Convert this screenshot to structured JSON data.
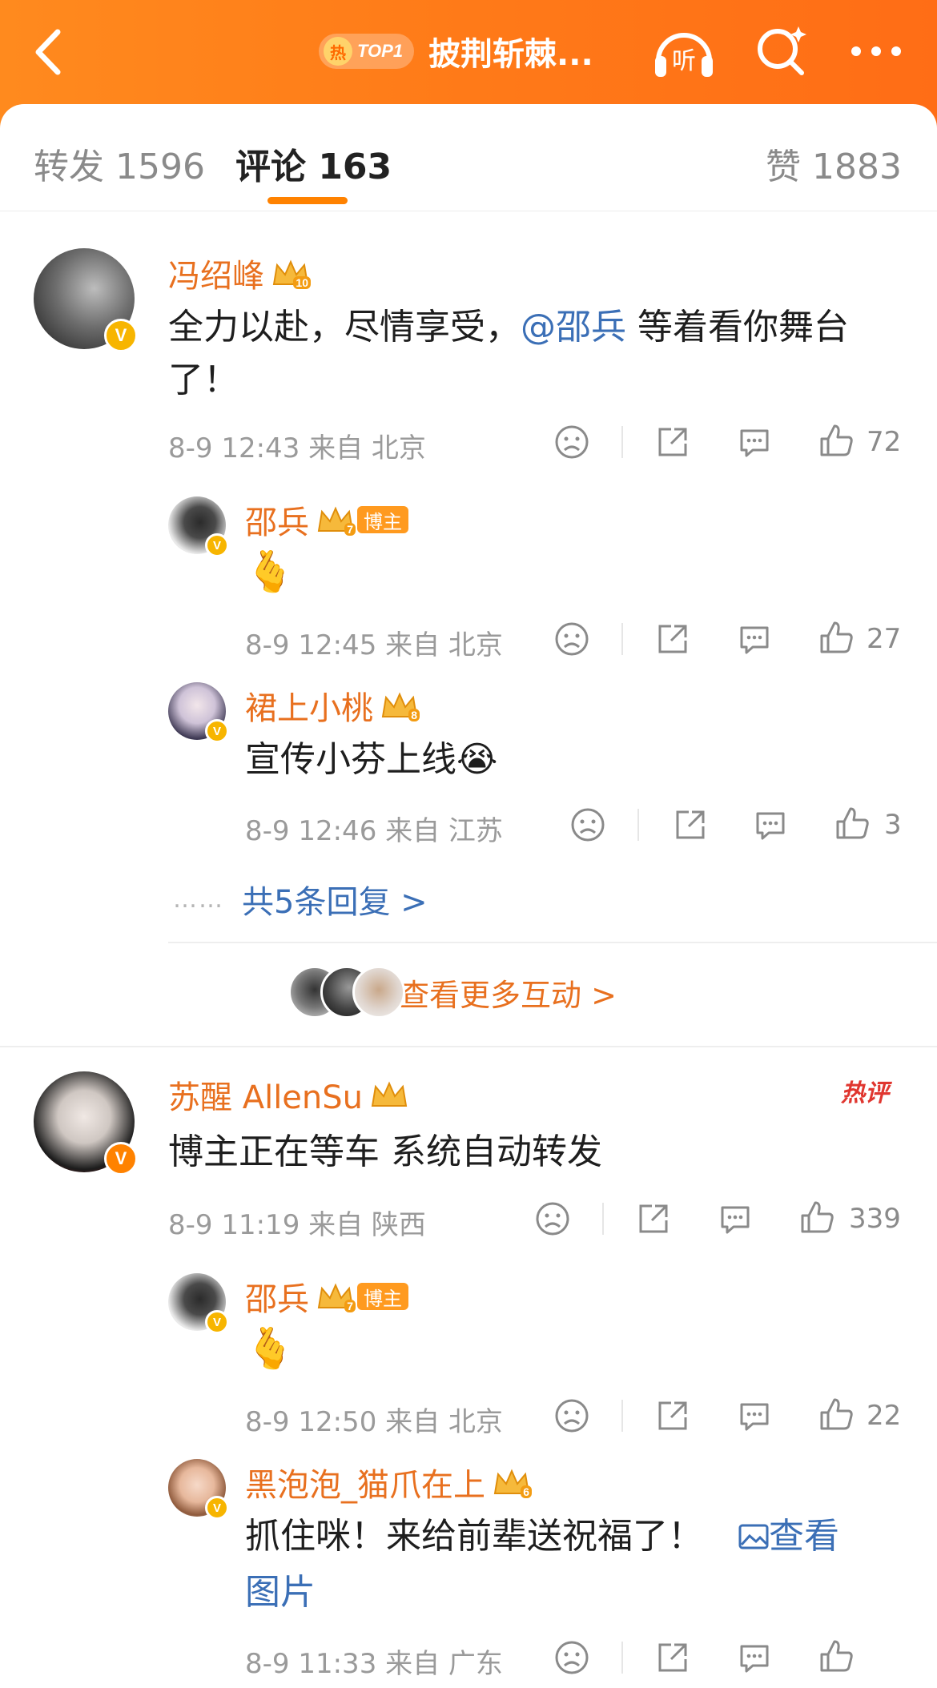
{
  "header": {
    "hot_badge_icon": "热",
    "hot_rank": "TOP1",
    "title": "披荆斩棘...",
    "listen_label": "听"
  },
  "tabs": {
    "repost": "转发 1596",
    "comment": "评论 163",
    "like": "赞 1883"
  },
  "comments": [
    {
      "name": "冯绍峰",
      "crown_level": "10",
      "text_before": "全力以赴，尽情享受，",
      "mention": "@邵兵",
      "text_after": " 等着看你舞台了！",
      "meta": "8-9 12:43 来自 北京",
      "likes": "72",
      "replies": [
        {
          "name": "邵兵",
          "crown_level": "7",
          "badge": "博主",
          "emoji": "🫰",
          "meta": "8-9 12:45 来自 北京",
          "likes": "27"
        },
        {
          "name": "裙上小桃",
          "crown_level": "8",
          "text": "宣传小芬上线",
          "emoji": "😭",
          "meta": "8-9 12:46 来自 江苏",
          "likes": "3"
        }
      ],
      "more_replies": "共5条回复 >",
      "more_replies_dots": "……",
      "interact_label": "查看更多互动 >"
    },
    {
      "name": "苏醒 AllenSu",
      "hot_tag": "热评",
      "text": "博主正在等车 系统自动转发",
      "meta": "8-9 11:19 来自 陕西",
      "likes": "339",
      "replies": [
        {
          "name": "邵兵",
          "crown_level": "7",
          "badge": "博主",
          "emoji": "🫰",
          "meta": "8-9 12:50 来自 北京",
          "likes": "22"
        },
        {
          "name": "黑泡泡_猫爪在上",
          "crown_level": "6",
          "text": "抓住咪！来给前辈送祝福了！",
          "link_line1": "查看",
          "link_line2": "图片",
          "meta": "8-9 11:33 来自 广东"
        }
      ]
    }
  ],
  "colors": {
    "header_orange": "#ff7a18",
    "name_orange": "#e8701f",
    "link_blue": "#3b6fb6",
    "meta_gray": "#9a9a9a",
    "verified_gold": "#f7b500"
  },
  "icons": [
    "back-icon",
    "listen-icon",
    "search-icon",
    "more-icon",
    "dislike-icon",
    "share-icon",
    "comment-icon",
    "like-icon",
    "crown-icon",
    "verified-icon",
    "image-icon"
  ]
}
